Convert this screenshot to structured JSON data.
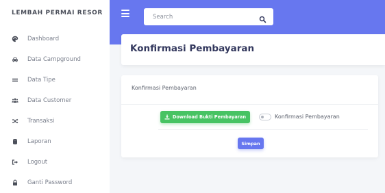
{
  "brand": "LEMBAH PERMAI RESOR",
  "colors": {
    "primary": "#6777ef",
    "success": "#47c363",
    "background": "#f4f6f9",
    "nav_icon": "#4b4f5a"
  },
  "sidebar": {
    "items": [
      {
        "label": "Dashboard",
        "icon": "palette-icon"
      },
      {
        "label": "Data Campground",
        "icon": "car-icon"
      },
      {
        "label": "Data Tipe",
        "icon": "equals-icon"
      },
      {
        "label": "Data Customer",
        "icon": "users-icon"
      },
      {
        "label": "Transaksi",
        "icon": "shuffle-icon"
      },
      {
        "label": "Laporan",
        "icon": "database-icon"
      },
      {
        "label": "Logout",
        "icon": "sign-out-icon"
      },
      {
        "label": "Ganti Password",
        "icon": "lock-icon"
      }
    ]
  },
  "topbar": {
    "menu_icon": "hamburger-icon",
    "search_placeholder": "Search",
    "search_icon": "search-icon"
  },
  "page": {
    "title": "Konfirmasi Pembayaran"
  },
  "card": {
    "title": "Konfirmasi Pembayaran",
    "download_button": "Download Bukti Pembayaran",
    "download_icon": "download-icon",
    "toggle_label": "Konfirmasi Pembayaran",
    "toggle_checked": false,
    "save_button": "Simpan"
  }
}
